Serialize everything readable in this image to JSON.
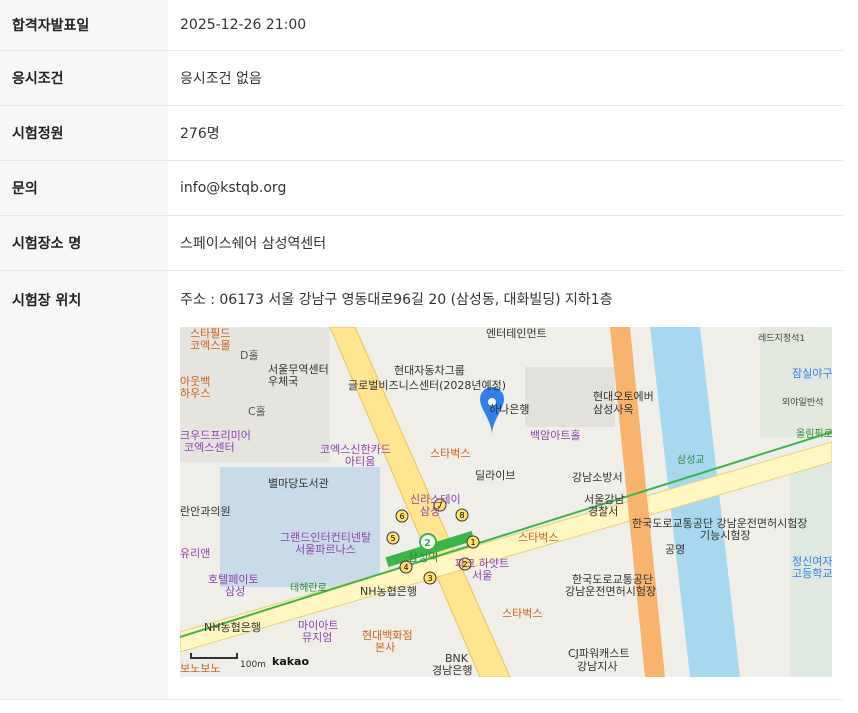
{
  "rows": [
    {
      "label": "합격자발표일",
      "value": "2025-12-26 21:00"
    },
    {
      "label": "응시조건",
      "value": "응시조건 없음"
    },
    {
      "label": "시험정원",
      "value": "276명"
    },
    {
      "label": "문의",
      "value": "info@kstqb.org"
    },
    {
      "label": "시험장소 명",
      "value": "스페이스쉐어 삼성역센터"
    }
  ],
  "location": {
    "label": "시험장 위치",
    "address": "주소 : 06173 서울 강남구 영동대로96길 20 (삼성동, 대화빌딩) 지하1층"
  },
  "map": {
    "places": {
      "starfield": "스타필드",
      "coex_mall": "코엑스몰",
      "d_hall": "D홀",
      "c_hall": "C홀",
      "seoul_trade_center": "서울무역센터",
      "post_office": "우체국",
      "hyundai_group": "현대자동차그룹",
      "gbc": "글로벌비즈니스센터(2028년예정)",
      "entertainment": "엔터테인먼트",
      "hana_bank": "하나은행",
      "hyundai_motor": "현대오토에버",
      "samsung_office": "삼성사옥",
      "outback1": "아웃백",
      "outback2": "하우스",
      "crowd1": "크우드프리미어",
      "crowd2": "코엑스센터",
      "coex_shinhan1": "코엑스신한카드",
      "coex_shinhan2": "아티움",
      "starbucks": "스타벅스",
      "baekam": "백암아트홀",
      "byeolmadang": "별마당도서관",
      "dilive": "딜라이브",
      "gangnam_fire": "강남소방서",
      "shilla1": "신라스테이",
      "shilla2": "삼성",
      "ranan": "란안과의원",
      "grand1": "그랜드인터컨티넨탈",
      "grand2": "서울파르나스",
      "yurian": "유리앤",
      "hotel_peito1": "호텔페이토",
      "hotel_peito2": "삼성",
      "samsung_station": "삼성역",
      "hyatt": "파크 하얏트",
      "hyatt2": "서울",
      "police1": "서울강남",
      "police2": "경찰서",
      "koroad1": "한국도로교통공단 강남운전면허시험장",
      "koroad2": "기능시험장",
      "park": "공영",
      "koroad3": "한국도로교통공단",
      "koroad4": "강남운전면허시험장",
      "teheran": "테헤란로",
      "nh_bank": "NH농협은행",
      "nh_bank2": "NH농협은행",
      "myart1": "마이아트",
      "myart2": "뮤지엄",
      "hyundai_dept1": "현대백화점",
      "hyundai_dept2": "본사",
      "bnk1": "BNK",
      "bnk2": "경남은행",
      "cj1": "CJ파워캐스트",
      "cj2": "강남지사",
      "samseong_bridge": "삼성교",
      "olympic": "올림픽로",
      "jamsil": "잠실야구",
      "jeongsin1": "정신여자",
      "jeongsin2": "고등학교",
      "reds": "레드지정석1",
      "outfield": "외야일반석",
      "bobo": "보노보노"
    },
    "scale": "100m",
    "brand": "kakao",
    "station_exits": [
      "1",
      "2",
      "3",
      "4",
      "5",
      "6",
      "7",
      "8"
    ],
    "line_number": "2"
  }
}
